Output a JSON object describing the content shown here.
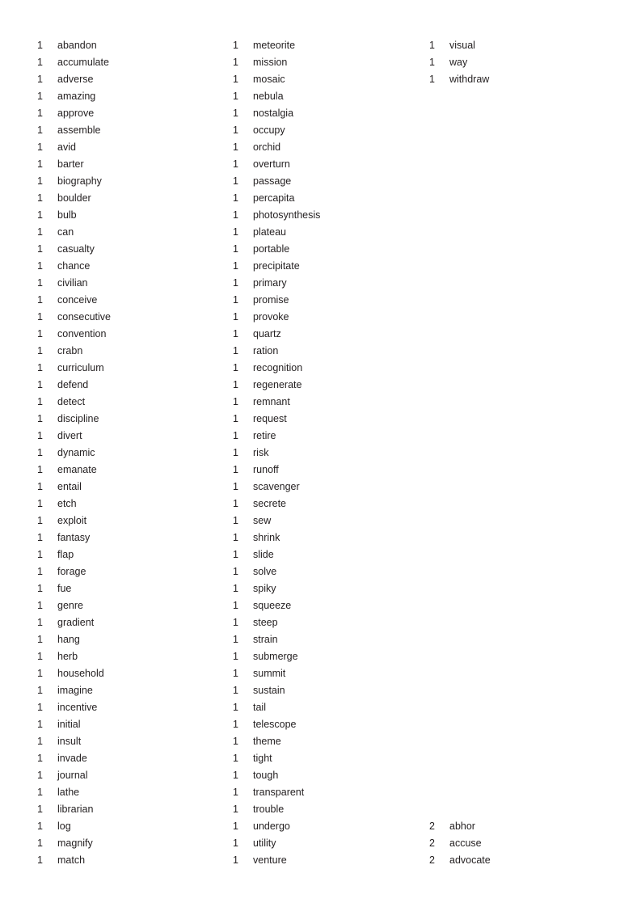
{
  "document": {
    "type": "word-frequency-list",
    "background_color": "#ffffff",
    "text_color": "#231f20",
    "column_count": 3
  },
  "columns": [
    {
      "name": "column-1",
      "entries": [
        {
          "count": "1",
          "word": "abandon"
        },
        {
          "count": "1",
          "word": "accumulate"
        },
        {
          "count": "1",
          "word": "adverse"
        },
        {
          "count": "1",
          "word": "amazing"
        },
        {
          "count": "1",
          "word": "approve"
        },
        {
          "count": "1",
          "word": "assemble"
        },
        {
          "count": "1",
          "word": "avid"
        },
        {
          "count": "1",
          "word": "barter"
        },
        {
          "count": "1",
          "word": "biography"
        },
        {
          "count": "1",
          "word": "boulder"
        },
        {
          "count": "1",
          "word": "bulb"
        },
        {
          "count": "1",
          "word": "can"
        },
        {
          "count": "1",
          "word": "casualty"
        },
        {
          "count": "1",
          "word": "chance"
        },
        {
          "count": "1",
          "word": "civilian"
        },
        {
          "count": "1",
          "word": "conceive"
        },
        {
          "count": "1",
          "word": "consecutive"
        },
        {
          "count": "1",
          "word": "convention"
        },
        {
          "count": "1",
          "word": "crabn"
        },
        {
          "count": "1",
          "word": "curriculum"
        },
        {
          "count": "1",
          "word": "defend"
        },
        {
          "count": "1",
          "word": "detect"
        },
        {
          "count": "1",
          "word": "discipline"
        },
        {
          "count": "1",
          "word": "divert"
        },
        {
          "count": "1",
          "word": "dynamic"
        },
        {
          "count": "1",
          "word": "emanate"
        },
        {
          "count": "1",
          "word": "entail"
        },
        {
          "count": "1",
          "word": "etch"
        },
        {
          "count": "1",
          "word": "exploit"
        },
        {
          "count": "1",
          "word": "fantasy"
        },
        {
          "count": "1",
          "word": "flap"
        },
        {
          "count": "1",
          "word": "forage"
        },
        {
          "count": "1",
          "word": "fue"
        },
        {
          "count": "1",
          "word": "genre"
        },
        {
          "count": "1",
          "word": "gradient"
        },
        {
          "count": "1",
          "word": "hang"
        },
        {
          "count": "1",
          "word": "herb"
        },
        {
          "count": "1",
          "word": "household"
        },
        {
          "count": "1",
          "word": "imagine"
        },
        {
          "count": "1",
          "word": "incentive"
        },
        {
          "count": "1",
          "word": "initial"
        },
        {
          "count": "1",
          "word": "insult"
        },
        {
          "count": "1",
          "word": "invade"
        },
        {
          "count": "1",
          "word": "journal"
        },
        {
          "count": "1",
          "word": "lathe"
        },
        {
          "count": "1",
          "word": "librarian"
        },
        {
          "count": "1",
          "word": "log"
        },
        {
          "count": "1",
          "word": "magnify"
        },
        {
          "count": "1",
          "word": "match"
        }
      ]
    },
    {
      "name": "column-2",
      "entries": [
        {
          "count": "1",
          "word": "meteorite"
        },
        {
          "count": "1",
          "word": "mission"
        },
        {
          "count": "1",
          "word": "mosaic"
        },
        {
          "count": "1",
          "word": "nebula"
        },
        {
          "count": "1",
          "word": "nostalgia"
        },
        {
          "count": "1",
          "word": "occupy"
        },
        {
          "count": "1",
          "word": "orchid"
        },
        {
          "count": "1",
          "word": "overturn"
        },
        {
          "count": "1",
          "word": "passage"
        },
        {
          "count": "1",
          "word": "percapita"
        },
        {
          "count": "1",
          "word": "photosynthesis"
        },
        {
          "count": "1",
          "word": "plateau"
        },
        {
          "count": "1",
          "word": "portable"
        },
        {
          "count": "1",
          "word": "precipitate"
        },
        {
          "count": "1",
          "word": "primary"
        },
        {
          "count": "1",
          "word": "promise"
        },
        {
          "count": "1",
          "word": "provoke"
        },
        {
          "count": "1",
          "word": "quartz"
        },
        {
          "count": "1",
          "word": "ration"
        },
        {
          "count": "1",
          "word": "recognition"
        },
        {
          "count": "1",
          "word": "regenerate"
        },
        {
          "count": "1",
          "word": "remnant"
        },
        {
          "count": "1",
          "word": "request"
        },
        {
          "count": "1",
          "word": "retire"
        },
        {
          "count": "1",
          "word": "risk"
        },
        {
          "count": "1",
          "word": "runoff"
        },
        {
          "count": "1",
          "word": "scavenger"
        },
        {
          "count": "1",
          "word": "secrete"
        },
        {
          "count": "1",
          "word": "sew"
        },
        {
          "count": "1",
          "word": "shrink"
        },
        {
          "count": "1",
          "word": "slide"
        },
        {
          "count": "1",
          "word": "solve"
        },
        {
          "count": "1",
          "word": "spiky"
        },
        {
          "count": "1",
          "word": "squeeze"
        },
        {
          "count": "1",
          "word": "steep"
        },
        {
          "count": "1",
          "word": "strain"
        },
        {
          "count": "1",
          "word": "submerge"
        },
        {
          "count": "1",
          "word": "summit"
        },
        {
          "count": "1",
          "word": "sustain"
        },
        {
          "count": "1",
          "word": "tail"
        },
        {
          "count": "1",
          "word": "telescope"
        },
        {
          "count": "1",
          "word": "theme"
        },
        {
          "count": "1",
          "word": "tight"
        },
        {
          "count": "1",
          "word": "tough"
        },
        {
          "count": "1",
          "word": "transparent"
        },
        {
          "count": "1",
          "word": "trouble"
        },
        {
          "count": "1",
          "word": "undergo"
        },
        {
          "count": "1",
          "word": "utility"
        },
        {
          "count": "1",
          "word": "venture"
        }
      ]
    },
    {
      "name": "column-3",
      "top_entries": [
        {
          "count": "1",
          "word": "visual"
        },
        {
          "count": "1",
          "word": "way"
        },
        {
          "count": "1",
          "word": "withdraw"
        }
      ],
      "gap_rows": 43,
      "bottom_entries": [
        {
          "count": "2",
          "word": "abhor"
        },
        {
          "count": "2",
          "word": "accuse"
        },
        {
          "count": "2",
          "word": "advocate"
        }
      ]
    }
  ]
}
